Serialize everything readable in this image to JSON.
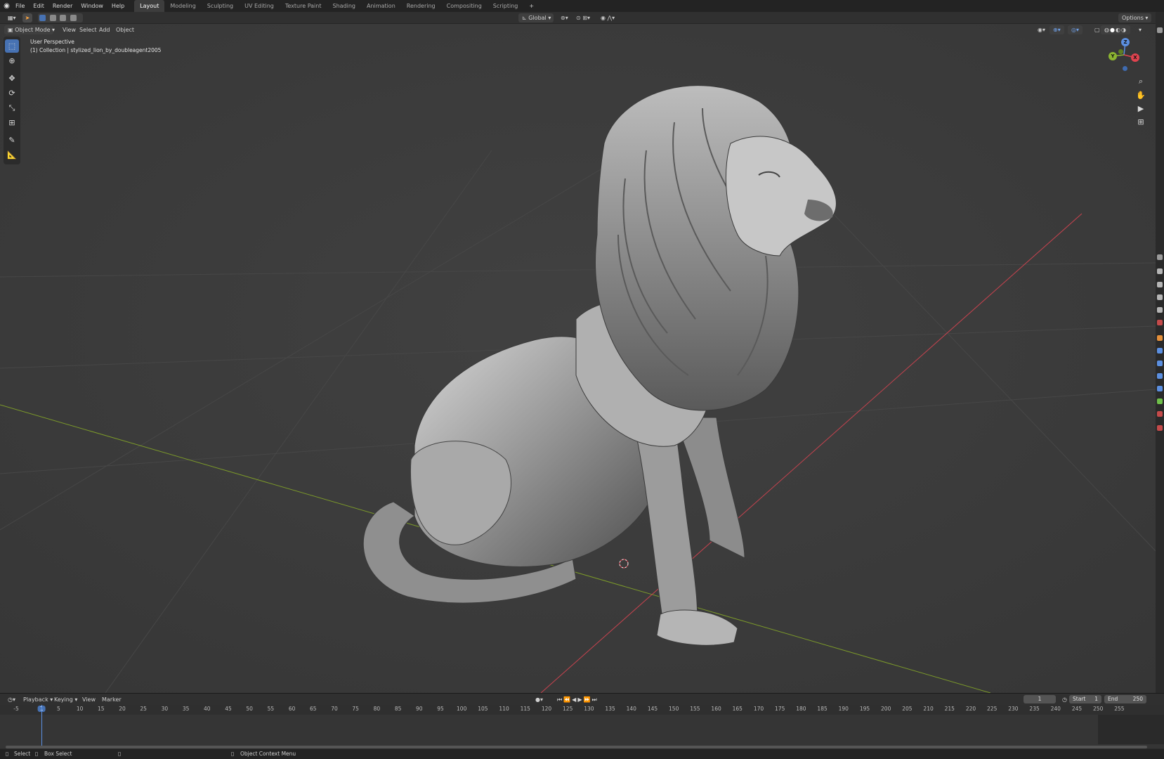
{
  "menu": [
    "File",
    "Edit",
    "Render",
    "Window",
    "Help"
  ],
  "workspaces": [
    {
      "label": "Layout",
      "active": true
    },
    {
      "label": "Modeling",
      "active": false
    },
    {
      "label": "Sculpting",
      "active": false
    },
    {
      "label": "UV Editing",
      "active": false
    },
    {
      "label": "Texture Paint",
      "active": false
    },
    {
      "label": "Shading",
      "active": false
    },
    {
      "label": "Animation",
      "active": false
    },
    {
      "label": "Rendering",
      "active": false
    },
    {
      "label": "Compositing",
      "active": false
    },
    {
      "label": "Scripting",
      "active": false
    }
  ],
  "add_workspace": "+",
  "header": {
    "transform_orientation": "Global",
    "options_label": "Options"
  },
  "viewport_header": {
    "mode": "Object Mode",
    "menus": [
      "View",
      "Select",
      "Add",
      "Object"
    ]
  },
  "viewport": {
    "perspective_label": "User Perspective",
    "collection_label": "(1) Collection | stylized_lion_by_doubleagent2005"
  },
  "gizmo": {
    "z": "Z",
    "y": "Y",
    "x": "X"
  },
  "timeline": {
    "menus": [
      "Playback",
      "Keying",
      "View",
      "Marker"
    ],
    "current_frame": "1",
    "start_label": "Start",
    "start_value": "1",
    "end_label": "End",
    "end_value": "250",
    "ticks": [
      "-5",
      "1",
      "5",
      "10",
      "15",
      "20",
      "25",
      "30",
      "35",
      "40",
      "45",
      "50",
      "55",
      "60",
      "65",
      "70",
      "75",
      "80",
      "85",
      "90",
      "95",
      "100",
      "105",
      "110",
      "115",
      "120",
      "125",
      "130",
      "135",
      "140",
      "145",
      "150",
      "155",
      "160",
      "165",
      "170",
      "175",
      "180",
      "185",
      "190",
      "195",
      "200",
      "205",
      "210",
      "215",
      "220",
      "225",
      "230",
      "235",
      "240",
      "245",
      "250",
      "255"
    ]
  },
  "statusbar": {
    "select": "Select",
    "box_select": "Box Select",
    "context_menu": "Object Context Menu"
  },
  "colors": {
    "accent": "#4772b3",
    "x_axis": "#c8434f",
    "y_axis": "#7c9a2a",
    "viewport_bg": "#3d3d3d"
  }
}
